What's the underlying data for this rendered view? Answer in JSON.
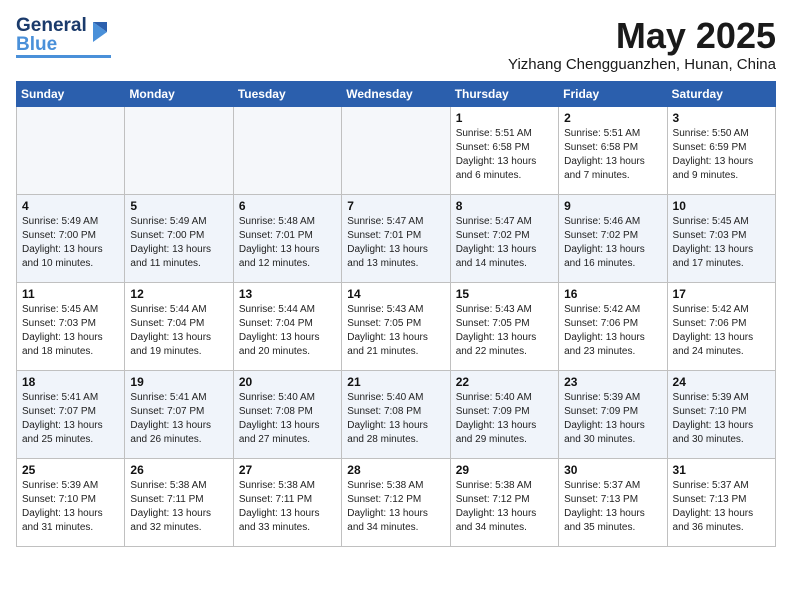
{
  "header": {
    "logo_line1": "General",
    "logo_line2": "Blue",
    "month_year": "May 2025",
    "location": "Yizhang Chengguanzhen, Hunan, China"
  },
  "days_of_week": [
    "Sunday",
    "Monday",
    "Tuesday",
    "Wednesday",
    "Thursday",
    "Friday",
    "Saturday"
  ],
  "weeks": [
    [
      {
        "day": "",
        "info": ""
      },
      {
        "day": "",
        "info": ""
      },
      {
        "day": "",
        "info": ""
      },
      {
        "day": "",
        "info": ""
      },
      {
        "day": "1",
        "info": "Sunrise: 5:51 AM\nSunset: 6:58 PM\nDaylight: 13 hours\nand 6 minutes."
      },
      {
        "day": "2",
        "info": "Sunrise: 5:51 AM\nSunset: 6:58 PM\nDaylight: 13 hours\nand 7 minutes."
      },
      {
        "day": "3",
        "info": "Sunrise: 5:50 AM\nSunset: 6:59 PM\nDaylight: 13 hours\nand 9 minutes."
      }
    ],
    [
      {
        "day": "4",
        "info": "Sunrise: 5:49 AM\nSunset: 7:00 PM\nDaylight: 13 hours\nand 10 minutes."
      },
      {
        "day": "5",
        "info": "Sunrise: 5:49 AM\nSunset: 7:00 PM\nDaylight: 13 hours\nand 11 minutes."
      },
      {
        "day": "6",
        "info": "Sunrise: 5:48 AM\nSunset: 7:01 PM\nDaylight: 13 hours\nand 12 minutes."
      },
      {
        "day": "7",
        "info": "Sunrise: 5:47 AM\nSunset: 7:01 PM\nDaylight: 13 hours\nand 13 minutes."
      },
      {
        "day": "8",
        "info": "Sunrise: 5:47 AM\nSunset: 7:02 PM\nDaylight: 13 hours\nand 14 minutes."
      },
      {
        "day": "9",
        "info": "Sunrise: 5:46 AM\nSunset: 7:02 PM\nDaylight: 13 hours\nand 16 minutes."
      },
      {
        "day": "10",
        "info": "Sunrise: 5:45 AM\nSunset: 7:03 PM\nDaylight: 13 hours\nand 17 minutes."
      }
    ],
    [
      {
        "day": "11",
        "info": "Sunrise: 5:45 AM\nSunset: 7:03 PM\nDaylight: 13 hours\nand 18 minutes."
      },
      {
        "day": "12",
        "info": "Sunrise: 5:44 AM\nSunset: 7:04 PM\nDaylight: 13 hours\nand 19 minutes."
      },
      {
        "day": "13",
        "info": "Sunrise: 5:44 AM\nSunset: 7:04 PM\nDaylight: 13 hours\nand 20 minutes."
      },
      {
        "day": "14",
        "info": "Sunrise: 5:43 AM\nSunset: 7:05 PM\nDaylight: 13 hours\nand 21 minutes."
      },
      {
        "day": "15",
        "info": "Sunrise: 5:43 AM\nSunset: 7:05 PM\nDaylight: 13 hours\nand 22 minutes."
      },
      {
        "day": "16",
        "info": "Sunrise: 5:42 AM\nSunset: 7:06 PM\nDaylight: 13 hours\nand 23 minutes."
      },
      {
        "day": "17",
        "info": "Sunrise: 5:42 AM\nSunset: 7:06 PM\nDaylight: 13 hours\nand 24 minutes."
      }
    ],
    [
      {
        "day": "18",
        "info": "Sunrise: 5:41 AM\nSunset: 7:07 PM\nDaylight: 13 hours\nand 25 minutes."
      },
      {
        "day": "19",
        "info": "Sunrise: 5:41 AM\nSunset: 7:07 PM\nDaylight: 13 hours\nand 26 minutes."
      },
      {
        "day": "20",
        "info": "Sunrise: 5:40 AM\nSunset: 7:08 PM\nDaylight: 13 hours\nand 27 minutes."
      },
      {
        "day": "21",
        "info": "Sunrise: 5:40 AM\nSunset: 7:08 PM\nDaylight: 13 hours\nand 28 minutes."
      },
      {
        "day": "22",
        "info": "Sunrise: 5:40 AM\nSunset: 7:09 PM\nDaylight: 13 hours\nand 29 minutes."
      },
      {
        "day": "23",
        "info": "Sunrise: 5:39 AM\nSunset: 7:09 PM\nDaylight: 13 hours\nand 30 minutes."
      },
      {
        "day": "24",
        "info": "Sunrise: 5:39 AM\nSunset: 7:10 PM\nDaylight: 13 hours\nand 30 minutes."
      }
    ],
    [
      {
        "day": "25",
        "info": "Sunrise: 5:39 AM\nSunset: 7:10 PM\nDaylight: 13 hours\nand 31 minutes."
      },
      {
        "day": "26",
        "info": "Sunrise: 5:38 AM\nSunset: 7:11 PM\nDaylight: 13 hours\nand 32 minutes."
      },
      {
        "day": "27",
        "info": "Sunrise: 5:38 AM\nSunset: 7:11 PM\nDaylight: 13 hours\nand 33 minutes."
      },
      {
        "day": "28",
        "info": "Sunrise: 5:38 AM\nSunset: 7:12 PM\nDaylight: 13 hours\nand 34 minutes."
      },
      {
        "day": "29",
        "info": "Sunrise: 5:38 AM\nSunset: 7:12 PM\nDaylight: 13 hours\nand 34 minutes."
      },
      {
        "day": "30",
        "info": "Sunrise: 5:37 AM\nSunset: 7:13 PM\nDaylight: 13 hours\nand 35 minutes."
      },
      {
        "day": "31",
        "info": "Sunrise: 5:37 AM\nSunset: 7:13 PM\nDaylight: 13 hours\nand 36 minutes."
      }
    ]
  ]
}
